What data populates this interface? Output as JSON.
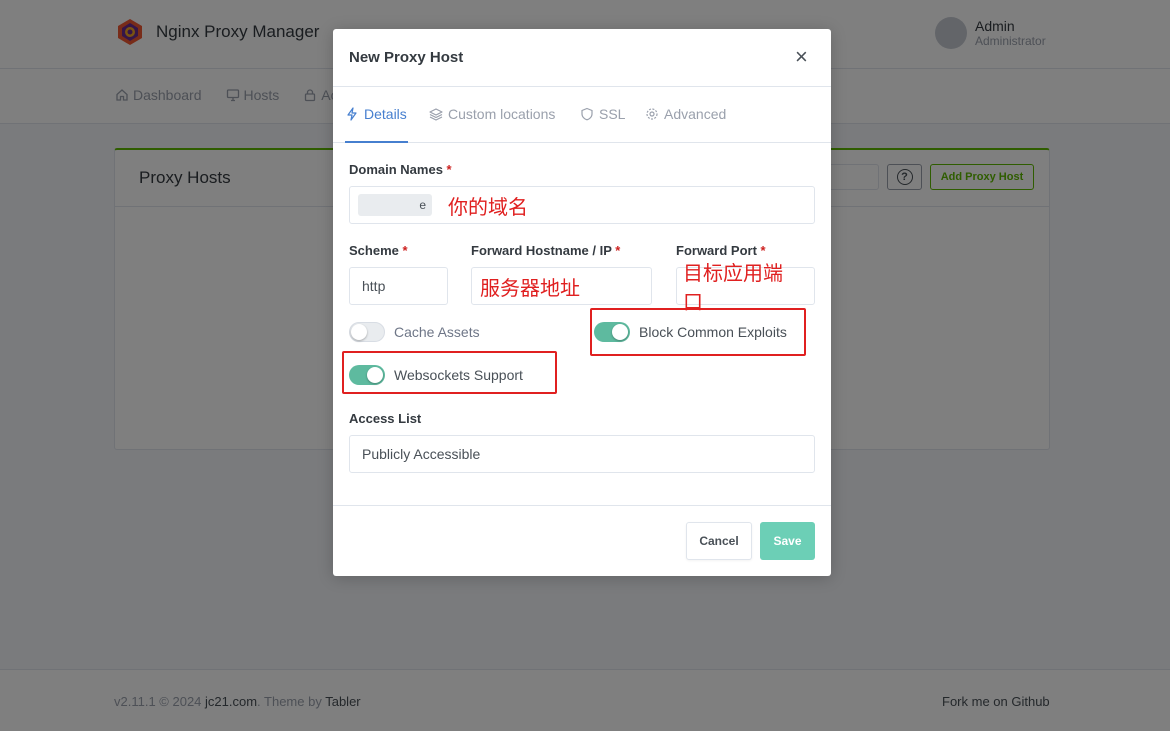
{
  "app": {
    "brand_name": "Nginx Proxy Manager",
    "user_name": "Admin",
    "user_role": "Administrator",
    "nav": [
      {
        "label": "Dashboard",
        "icon": "home-icon"
      },
      {
        "label": "Hosts",
        "icon": "monitor-icon"
      },
      {
        "label": "Ac",
        "icon": "lock-icon"
      }
    ],
    "card_title": "Proxy Hosts",
    "add_button": "Add Proxy Host",
    "help_icon": "?",
    "footer_prefix": "v2.11.1 © 2024 ",
    "footer_link": "jc21.com",
    "footer_mid": ". Theme by ",
    "footer_theme": "Tabler",
    "footer_right": "Fork me on Github"
  },
  "modal": {
    "title": "New Proxy Host",
    "close": "×",
    "tabs": [
      {
        "label": "Details",
        "icon": "bolt-icon",
        "active": true
      },
      {
        "label": "Custom locations",
        "icon": "layers-icon",
        "active": false
      },
      {
        "label": "SSL",
        "icon": "shield-icon",
        "active": false
      },
      {
        "label": "Advanced",
        "icon": "gear-icon",
        "active": false
      }
    ],
    "domain_label": "Domain Names",
    "domain_chip": "e",
    "domain_note": "你的域名",
    "scheme_label": "Scheme",
    "scheme_value": "http",
    "host_label": "Forward Hostname / IP",
    "host_note": "服务器地址",
    "port_label": "Forward Port",
    "port_note": "目标应用端口",
    "required_mark": "*",
    "cache_assets": {
      "label": "Cache Assets",
      "on": false
    },
    "block_exploits": {
      "label": "Block Common Exploits",
      "on": true
    },
    "websockets": {
      "label": "Websockets Support",
      "on": true
    },
    "access_label": "Access List",
    "access_value": "Publicly Accessible",
    "cancel": "Cancel",
    "save": "Save"
  },
  "colors": {
    "primary": "#467fcf",
    "success": "#5eba00",
    "toggle_on": "#5eba9f",
    "save_button": "#6ccfb6",
    "annotation": "#e02020"
  }
}
